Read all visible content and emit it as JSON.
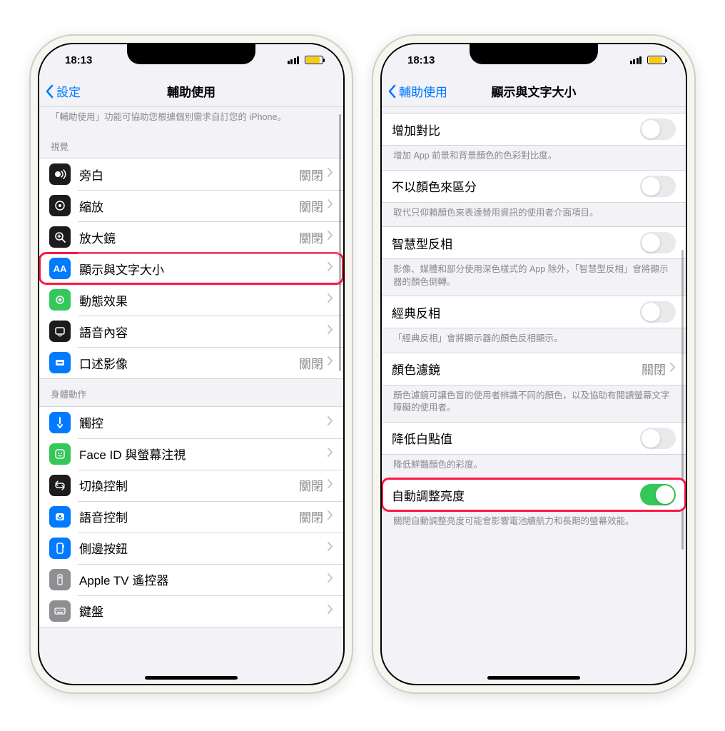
{
  "status": {
    "time": "18:13"
  },
  "left": {
    "back": "設定",
    "title": "輔助使用",
    "intro": "「輔助使用」功能可協助您根據個別需求自訂您的 iPhone。",
    "vision_header": "視覺",
    "rows_vision": [
      {
        "label": "旁白",
        "value": "關閉"
      },
      {
        "label": "縮放",
        "value": "關閉"
      },
      {
        "label": "放大鏡",
        "value": "關閉"
      },
      {
        "label": "顯示與文字大小",
        "value": ""
      },
      {
        "label": "動態效果",
        "value": ""
      },
      {
        "label": "語音內容",
        "value": ""
      },
      {
        "label": "口述影像",
        "value": "關閉"
      }
    ],
    "motion_header": "身體動作",
    "rows_motion": [
      {
        "label": "觸控",
        "value": ""
      },
      {
        "label": "Face ID 與螢幕注視",
        "value": ""
      },
      {
        "label": "切換控制",
        "value": "關閉"
      },
      {
        "label": "語音控制",
        "value": "關閉"
      },
      {
        "label": "側邊按鈕",
        "value": ""
      },
      {
        "label": "Apple TV 遙控器",
        "value": ""
      },
      {
        "label": "鍵盤",
        "value": ""
      }
    ]
  },
  "right": {
    "back": "輔助使用",
    "title": "顯示與文字大小",
    "rows": [
      {
        "label": "增加對比",
        "footer": "增加 App 前景和背景顏色的色彩對比度。",
        "toggle": false
      },
      {
        "label": "不以顏色來區分",
        "footer": "取代只仰賴顏色來表達替用資訊的使用者介面項目。",
        "toggle": false
      },
      {
        "label": "智慧型反相",
        "footer": "影像、媒體和部分使用深色樣式的 App 除外，「智慧型反相」會將顯示器的顏色倒轉。",
        "toggle": false
      },
      {
        "label": "經典反相",
        "footer": "「經典反相」會將顯示器的顏色反相顯示。",
        "toggle": false
      },
      {
        "label": "顏色濾鏡",
        "value": "關閉",
        "footer": "顏色濾鏡可讓色盲的使用者辨識不同的顏色，以及協助有閱讀螢幕文字障礙的使用者。",
        "chevron": true
      },
      {
        "label": "降低白點值",
        "footer": "降低鮮豔顏色的彩度。",
        "toggle": false
      },
      {
        "label": "自動調整亮度",
        "footer": "關閉自動調整亮度可能會影響電池續航力和長期的螢幕效能。",
        "toggle": true,
        "highlight": true
      }
    ]
  }
}
